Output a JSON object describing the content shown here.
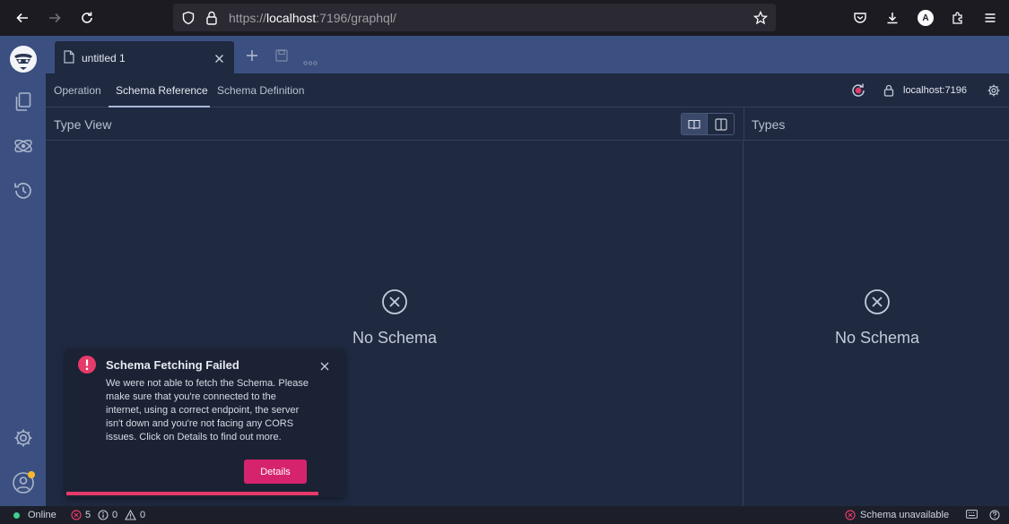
{
  "browser": {
    "url_scheme_prefix": "https://",
    "url_host": "localhost",
    "url_rest": ":7196/graphql/",
    "profile_initial": "A"
  },
  "tabs": [
    {
      "label": "untitled 1"
    }
  ],
  "subtabs": {
    "operation": "Operation",
    "schema_reference": "Schema Reference",
    "schema_definition": "Schema Definition"
  },
  "connection": {
    "endpoint": "localhost:7196"
  },
  "type_view": {
    "header": "Type View",
    "empty_text": "No Schema"
  },
  "types_panel": {
    "header": "Types",
    "empty_text": "No Schema"
  },
  "toast": {
    "title": "Schema Fetching Failed",
    "body": "We were not able to fetch the Schema. Please make sure that you're connected to the internet, using a correct endpoint, the server isn't down and you're not facing any CORS issues. Click on Details to find out more.",
    "button": "Details"
  },
  "status": {
    "online": "Online",
    "errors": "5",
    "info": "0",
    "warnings": "0",
    "schema_status": "Schema unavailable"
  },
  "colors": {
    "accent": "#d6236d",
    "error": "#e53a6a",
    "sidebar": "#3b5080",
    "panel": "#1f2940",
    "online": "#3ecf8e"
  }
}
